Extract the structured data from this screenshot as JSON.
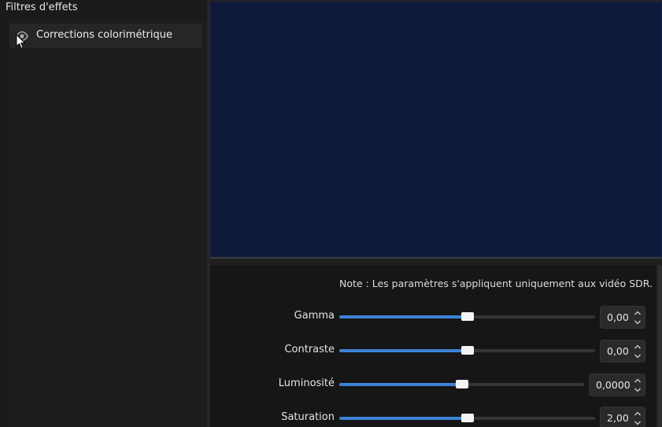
{
  "filters_panel": {
    "title": "Filtres d'effets",
    "items": [
      {
        "label": "Corrections colorimétrique",
        "icon": "eye-icon",
        "visible": true
      }
    ]
  },
  "properties": {
    "note": "Note : Les paramètres s'appliquent uniquement aux vidéo SDR.",
    "controls": [
      {
        "label": "Gamma",
        "value": "0,00",
        "slider_fraction": 0.5
      },
      {
        "label": "Contraste",
        "value": "0,00",
        "slider_fraction": 0.5
      },
      {
        "label": "Luminosité",
        "value": "0,0000",
        "slider_fraction": 0.5
      },
      {
        "label": "Saturation",
        "value": "2,00",
        "slider_fraction": 0.5
      }
    ]
  },
  "colors": {
    "accent": "#3b82d6",
    "preview_background": "#0e1838"
  }
}
